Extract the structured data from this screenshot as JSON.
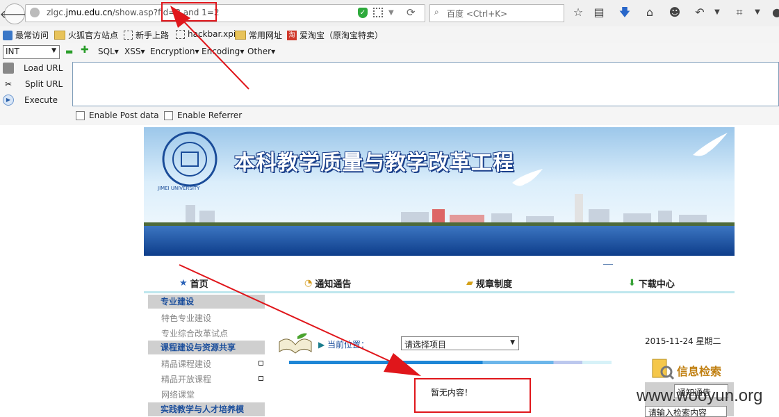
{
  "browser": {
    "url_prefix": "zlgc.",
    "url_domain": "jmu.edu.cn",
    "url_suffix": "/show.asp?fid=3 and 1=2",
    "search_placeholder": "百度 <Ctrl+K>"
  },
  "bookmarks": [
    {
      "label": "最常访问",
      "icon": "search-icon"
    },
    {
      "label": "火狐官方站点",
      "icon": "folder-icon"
    },
    {
      "label": "新手上路",
      "icon": "page-icon"
    },
    {
      "label": "hackbar.xpi",
      "icon": "page-icon"
    },
    {
      "label": "常用网址",
      "icon": "folder-icon"
    },
    {
      "label": "爱淘宝（原淘宝特卖）",
      "icon": "taobao-icon"
    }
  ],
  "hackbar": {
    "select_value": "INT",
    "menus": [
      "SQL",
      "XSS",
      "Encryption",
      "Encoding",
      "Other"
    ],
    "load_url": "Load URL",
    "split_url": "Split URL",
    "execute": "Execute",
    "enable_post": "Enable Post data",
    "enable_referrer": "Enable Referrer"
  },
  "site": {
    "banner_title": "本科教学质量与教学改革工程",
    "logo_text": "JIMEI UNIVERSITY",
    "nav": [
      "首页",
      "通知通告",
      "规章制度",
      "下载中心"
    ],
    "sidebar": [
      {
        "type": "head",
        "label": "专业建设"
      },
      {
        "type": "link",
        "label": "特色专业建设"
      },
      {
        "type": "link",
        "label": "专业综合改革试点"
      },
      {
        "type": "head",
        "label": "课程建设与资源共享"
      },
      {
        "type": "link",
        "label": "精品课程建设"
      },
      {
        "type": "link",
        "label": "精品开放课程"
      },
      {
        "type": "link",
        "label": "网络课堂"
      },
      {
        "type": "head",
        "label": "实践教学与人才培养模"
      }
    ],
    "location_label": "当前位置：",
    "project_select": "请选择项目",
    "empty_content": "暂无内容！",
    "date": "2015-11-24 星期二",
    "search_title": "信息检索",
    "search_category": "通知通告",
    "search_placeholder": "请输入检索内容"
  },
  "watermark": "www.wooyun.org",
  "colors": {
    "annotation_red": "#e0161b",
    "nav_link": "#1c4f9c"
  }
}
